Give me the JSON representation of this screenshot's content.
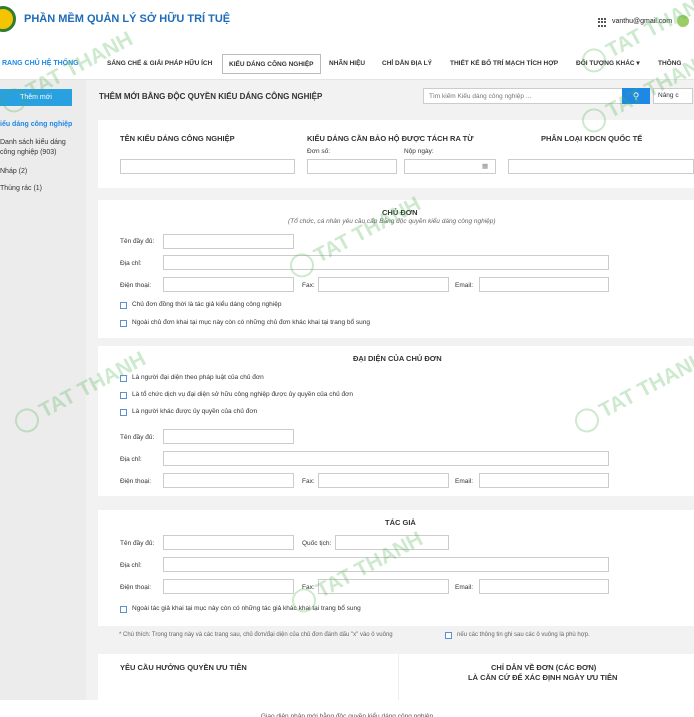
{
  "header": {
    "app_title": "PHẦN MỀM QUẢN LÝ SỞ HỮU TRÍ TUỆ",
    "user_email": "vanthu@gmail.com"
  },
  "nav": {
    "system_tab": "RANG CHỦ HỆ THỐNG",
    "tabs": [
      "SÁNG CHẾ & GIẢI PHÁP HỮU ÍCH",
      "KIỂU DÁNG CÔNG NGHIỆP",
      "NHÃN HIỆU",
      "CHỈ DẪN ĐỊA LÝ",
      "THIẾT KẾ BỐ TRÍ MẠCH TÍCH HỢP",
      "ĐỐI TƯỢNG KHÁC ▾",
      "THÔNG"
    ],
    "active_tab": "KIỂU DÁNG CÔNG NGHIỆP"
  },
  "sidebar": {
    "new_button": "Thêm mới",
    "group": "iểu dáng công nghiệp",
    "items": [
      "Danh sách kiểu dáng\ncông nghiệp (903)",
      "Nháp (2)",
      "Thùng rác (1)"
    ]
  },
  "main": {
    "page_title": "THÊM MỚI BẰNG ĐỘC QUYỀN KIỂU DÁNG CÔNG NGHIỆP",
    "search_placeholder": "Tìm kiếm Kiểu dáng công nghiệp ...",
    "advanced_button": "Nâng c"
  },
  "design": {
    "name_header": "TÊN KIỂU DÁNG CÔNG NGHIỆP",
    "separate_header": "KIỂU DÁNG CẦN BẢO HỘ ĐƯỢC TÁCH RA TỪ",
    "app_no_label": "Đơn số:",
    "filing_date_label": "Nộp ngày:",
    "classification_header": "PHÂN LOẠI KDCN QUỐC TẾ"
  },
  "owner": {
    "title": "CHỦ ĐƠN",
    "subtitle": "(Tổ chức, cá nhân yêu cầu cấp Bằng độc quyền kiểu dáng công nghiệp)",
    "full_name": "Tên đầy đủ:",
    "address": "Địa chỉ:",
    "phone": "Điện thoại:",
    "fax": "Fax:",
    "email": "Email:",
    "check1": "Chủ đơn đồng thời là tác giả kiểu dáng công nghiệp",
    "check2": "Ngoài chủ đơn khai tại mục này còn có những chủ đơn khác khai tại trang bổ sung"
  },
  "rep": {
    "title": "ĐẠI DIỆN CỦA CHỦ ĐƠN",
    "check1": "Là người đại diện theo pháp luật của chủ đơn",
    "check2": "Là tổ chức dịch vụ đại diện sở hữu công nghiệp được ủy quyền của chủ đơn",
    "check3": "Là người khác được ủy quyền của chủ đơn",
    "full_name": "Tên đầy đủ:",
    "address": "Địa chỉ:",
    "phone": "Điện thoại:",
    "fax": "Fax:",
    "email": "Email:"
  },
  "author": {
    "title": "TÁC GIẢ",
    "full_name": "Tên đầy đủ:",
    "nationality": "Quốc tịch:",
    "address": "Địa chỉ:",
    "phone": "Điện thoại:",
    "fax": "Fax:",
    "email": "Email:",
    "check1": "Ngoài tác giả khai tại mục này còn có những tác giả khác khai tại trang bổ sung"
  },
  "note": {
    "text1": "* Chú thích: Trong trang này và các trang sau, chủ đơn/đại diện của chủ đơn đánh dấu \"x\" vào ô vuông",
    "text2": "nếu các thông tin ghi sau các ô vuông là phù hợp."
  },
  "bottom": {
    "priority": "YÊU CẦU HƯỞNG QUYỀN ƯU TIÊN",
    "basis_line1": "CHỈ DẪN VỀ ĐƠN (CÁC ĐƠN)",
    "basis_line2": "LÀ CĂN CỨ ĐỂ XÁC ĐỊNH NGÀY ƯU TIÊN"
  },
  "watermark": "TAT THANH",
  "caption": "Giao diện nhập mới bằng độc quyền kiểu dáng công nghiệp",
  "colors": {
    "primary": "#1e88e5",
    "sidebar_bg": "#ececec",
    "main_bg": "#f2f2f2",
    "watermark": "#4caf50"
  }
}
